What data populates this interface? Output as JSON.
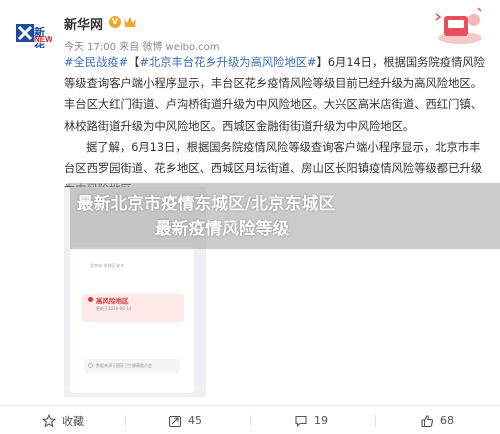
{
  "post": {
    "author": "新华网",
    "vip_mark": "V",
    "meta": "今天 17:00 来自 微博 weibo.com",
    "content": {
      "topic1": "#全民战疫#",
      "bracket_open": "【",
      "topic2": "#北京丰台花乡升级为高风险地区#",
      "body_after_topic": "】6月14日，根据国务院疫情风险等级查询客户端小程序显示，丰台区花乡疫情风险等级目前已经升级为高风险地区。丰台区大红门街道、卢沟桥街道升级为中风险地区。大兴区高米店街道、西红门镇、林校路街道升级为中风险地区。西城区金融街街道升级为中风险地区。",
      "paragraph2": "据了解，6月13日，根据国务院疫情风险等级查询客户端小程序显示，北京市丰台区西罗园街道、花乡地区、西城区月坛街道、房山区长阳镇疫情风险等级都已升级为中风险地区。"
    }
  },
  "image": {
    "risk_title": "高风险地区",
    "caption_top": "北京市 丰台区 花乡",
    "caption_date": "更新于2020-06-14",
    "caption_note": "数据来源于国家卫生健康委员会"
  },
  "overlay": {
    "line1": "最新北京市疫情东城区/北京东城区",
    "line2": "最新疫情风险等级"
  },
  "toolbar": {
    "favorite_label": "收藏",
    "repost_count": "45",
    "comment_count": "19",
    "like_count": "68"
  },
  "colors": {
    "topic_link": "#3b6db2",
    "vip_badge": "#f2a42e",
    "risk_red": "#d23a3a"
  }
}
